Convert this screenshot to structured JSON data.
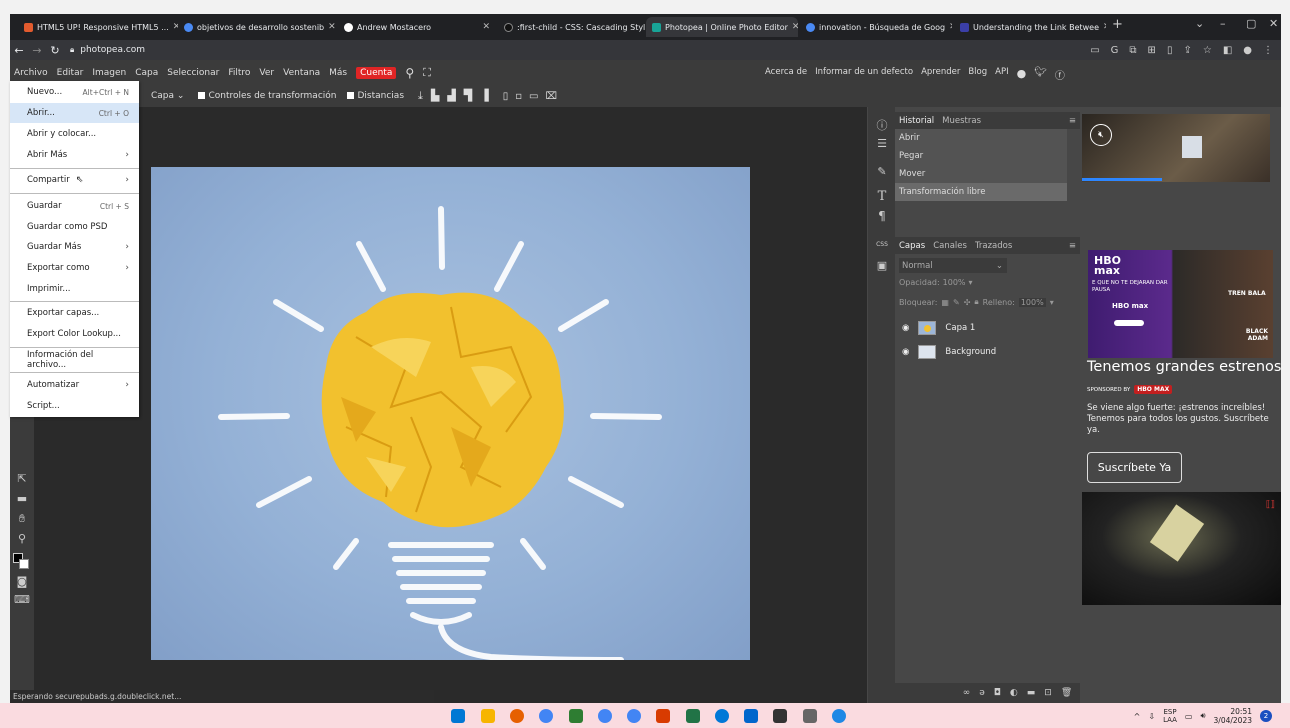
{
  "browser": {
    "tabs": [
      {
        "label": "HTML5 UP! Responsive HTML5 ...",
        "color": "#e25b2e"
      },
      {
        "label": "objetivos de desarrollo sostenib",
        "color": "#4a8af4"
      },
      {
        "label": "Andrew Mostacero",
        "color": "#ffffff"
      },
      {
        "label": ":first-child - CSS: Cascading Styl",
        "color": "#111111"
      },
      {
        "label": "Photopea | Online Photo Editor",
        "color": "#18a497"
      },
      {
        "label": "innovation - Búsqueda de Goog",
        "color": "#4a8af4"
      },
      {
        "label": "Understanding the Link Betwee",
        "color": "#3b3fa8"
      }
    ],
    "url": "photopea.com",
    "new_tab": "+",
    "window_controls": [
      "⌄",
      "–",
      "▢",
      "✕"
    ]
  },
  "menubar": {
    "items": [
      "Archivo",
      "Editar",
      "Imagen",
      "Capa",
      "Seleccionar",
      "Filtro",
      "Ver",
      "Ventana",
      "Más"
    ],
    "account": "Cuenta",
    "right_links": [
      "Acerca de",
      "Informar de un defecto",
      "Aprender",
      "Blog",
      "API"
    ]
  },
  "options_bar": {
    "select_value": "Capa",
    "transform_controls": "Controles de transformación",
    "distances": "Distancias"
  },
  "file_menu": {
    "items": [
      {
        "label": "Nuevo...",
        "shortcut": "Alt+Ctrl + N"
      },
      {
        "label": "Abrir...",
        "shortcut": "Ctrl + O"
      },
      {
        "label": "Abrir y colocar..."
      },
      {
        "label": "Abrir Más",
        "submenu": true
      },
      {
        "label": "Compartir",
        "submenu": true
      },
      {
        "label": "Guardar",
        "shortcut": "Ctrl + S"
      },
      {
        "label": "Guardar como PSD"
      },
      {
        "label": "Guardar Más",
        "submenu": true
      },
      {
        "label": "Exportar como",
        "submenu": true
      },
      {
        "label": "Imprimir..."
      },
      {
        "label": "Exportar capas..."
      },
      {
        "label": "Export Color Lookup..."
      },
      {
        "label": "Información del archivo..."
      },
      {
        "label": "Automatizar",
        "submenu": true
      },
      {
        "label": "Script..."
      }
    ]
  },
  "history_panel": {
    "tabs": [
      "Historial",
      "Muestras"
    ],
    "entries": [
      "Abrir",
      "Pegar",
      "Mover",
      "Transformación libre"
    ]
  },
  "layers_panel": {
    "tabs": [
      "Capas",
      "Canales",
      "Trazados"
    ],
    "blend_mode": "Normal",
    "opacity_label": "Opacidad:",
    "opacity_value": "100%",
    "lock_label": "Bloquear:",
    "fill_label": "Relleno:",
    "fill_value": "100%",
    "layers": [
      "Capa 1",
      "Background"
    ]
  },
  "right_strip": {
    "css_label": "CSS"
  },
  "ad": {
    "brand": "HBO max",
    "ad_caption": "E   QUE NO TE DEJARAN DAR PAUSA",
    "poster_labels": [
      "TREN BALA",
      "BLACK ADAM"
    ],
    "headline": "Tenemos grandes estrenos",
    "sponsored_by": "SPONSORED BY",
    "sponsor": "HBO MAX",
    "body": "Se viene algo fuerte: ¡estrenos increíbles! Tenemos para todos los gustos. Suscríbete ya.",
    "cta": "Suscríbete Ya"
  },
  "status": "Esperando securepubads.g.doubleclick.net...",
  "taskbar": {
    "lang": "ESP",
    "lang_sub": "LAA",
    "time": "20:51",
    "date": "3/04/2023",
    "notifications": "2",
    "apps": [
      "#0078d4",
      "#f7b500",
      "#e66000",
      "#4285f4",
      "#2e7d32",
      "#4285f4",
      "#4285f4",
      "#d83b01",
      "#217346",
      "#0078d7",
      "#0066cc",
      "#333333",
      "#666666",
      "#1e88e5"
    ]
  }
}
